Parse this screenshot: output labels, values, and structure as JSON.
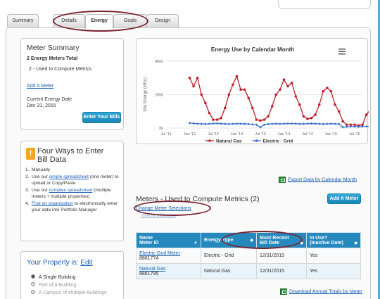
{
  "tabs": [
    {
      "label": "Summary"
    },
    {
      "label": "Details"
    },
    {
      "label": "Energy"
    },
    {
      "label": "Goals"
    },
    {
      "label": "Design"
    }
  ],
  "meter_summary": {
    "title": "Meter Summary",
    "total": "2 Energy Meters Total",
    "used": "2 - Used to Compute Metrics",
    "add_meter": "Add A Meter",
    "current_date_label": "Current Energy Date",
    "current_date": "Dec 31, 2015",
    "enter_bills": "Enter Your Bills"
  },
  "four_ways": {
    "title_line1": "Four Ways to Enter",
    "title_line2": "Bill Data",
    "items": [
      {
        "n": "1.",
        "pre": "Manually",
        "link": "",
        "post": ""
      },
      {
        "n": "2.",
        "pre": "Use our ",
        "link": "simple spreadsheet",
        "post": " (one meter) to upload or Copy/Paste"
      },
      {
        "n": "3.",
        "pre": "Use our ",
        "link": "complex spreadsheet",
        "post": " (multiple meters + multiple properties)"
      },
      {
        "n": "4.",
        "pre": "",
        "link": "Find an organization",
        "post": " to electronically enter your data into Portfolio Manager"
      }
    ]
  },
  "property": {
    "title": "Your Property is:",
    "edit": "Edit",
    "options": [
      {
        "label": "A Single Building",
        "selected": true
      },
      {
        "label": "Part of a Building",
        "selected": false
      },
      {
        "label": "A Campus of Multiple Buildings",
        "selected": false
      }
    ]
  },
  "chart_data": {
    "type": "line",
    "title": "Energy Use by Calendar Month",
    "xlabel": "",
    "ylabel": "Site Energy (kBtu)",
    "ylim": [
      0,
      400000
    ],
    "yticks": [
      "0k",
      "200k",
      "400k"
    ],
    "xticks": [
      "Jul '11",
      "Jan '12",
      "Jul '12",
      "Jan '13",
      "Jul '13",
      "Jan '14",
      "Jul '14",
      "Jan '15",
      "Jul '15"
    ],
    "legend_position": "bottom",
    "x": [
      "Jan '12",
      "Feb '12",
      "Mar '12",
      "Apr '12",
      "May '12",
      "Jun '12",
      "Jul '12",
      "Aug '12",
      "Sep '12",
      "Oct '12",
      "Nov '12",
      "Dec '12",
      "Jan '13",
      "Feb '13",
      "Mar '13",
      "Apr '13",
      "May '13",
      "Jun '13",
      "Jul '13",
      "Aug '13",
      "Sep '13",
      "Oct '13",
      "Nov '13",
      "Dec '13",
      "Jan '14",
      "Feb '14",
      "Mar '14",
      "Apr '14",
      "May '14",
      "Jun '14",
      "Jul '14",
      "Aug '14",
      "Sep '14",
      "Oct '14",
      "Nov '14",
      "Dec '14",
      "Jan '15",
      "Feb '15",
      "Mar '15",
      "Apr '15",
      "May '15",
      "Jun '15",
      "Jul '15",
      "Aug '15",
      "Sep '15",
      "Oct '15",
      "Nov '15",
      "Dec '15"
    ],
    "series": [
      {
        "name": "Natural Gas",
        "color": "#c0202a",
        "values": [
          300000,
          250000,
          300000,
          200000,
          150000,
          90000,
          50000,
          50000,
          60000,
          120000,
          200000,
          260000,
          310000,
          230000,
          230000,
          180000,
          120000,
          50000,
          45000,
          50000,
          70000,
          130000,
          200000,
          230000,
          290000,
          250000,
          270000,
          190000,
          140000,
          70000,
          55000,
          60000,
          80000,
          140000,
          220000,
          240000,
          220000,
          140000,
          100000,
          40000,
          20000,
          20000,
          20000,
          15000,
          20000,
          80000,
          110000,
          200000
        ]
      },
      {
        "name": "Electric - Grid",
        "color": "#3a6fd0",
        "values": [
          30000,
          28000,
          26000,
          25000,
          24000,
          25000,
          27000,
          28000,
          26000,
          25000,
          24000,
          25000,
          26000,
          26000,
          25000,
          24000,
          22000,
          20000,
          5000,
          20000,
          24000,
          25000,
          26000,
          25000,
          26000,
          27000,
          27000,
          26000,
          25000,
          25000,
          26000,
          27000,
          26000,
          25000,
          24000,
          25000,
          26000,
          25000,
          24000,
          5000,
          8000,
          10000,
          9000,
          8000,
          9000,
          10000,
          9000,
          8000
        ]
      }
    ]
  },
  "export_link": "Export Data by Calendar Month",
  "meters": {
    "title": "Meters - Used to Compute Metrics (2)",
    "change": "Change Meter Selections",
    "ghost": "View as a Diagram",
    "add_button": "Add A Meter",
    "columns": [
      "Name",
      "Meter ID",
      "Energy Type",
      "Most Recent",
      "Bill Date",
      "In Use?",
      "(Inactive Date)"
    ],
    "rows": [
      {
        "name": "Electric Grid Meter",
        "id": "8861774",
        "type": "Electric - Grid",
        "date": "12/31/2015",
        "inuse": "Yes"
      },
      {
        "name": "Natural Gas",
        "id": "8861795",
        "type": "Natural Gas",
        "date": "12/31/2015",
        "inuse": "Yes"
      }
    ],
    "download": "Download Annual Totals by Meter"
  },
  "colors": {
    "accent": "#2589bd",
    "annotation": "#7a2430",
    "gas": "#c0202a",
    "electric": "#3a6fd0"
  }
}
